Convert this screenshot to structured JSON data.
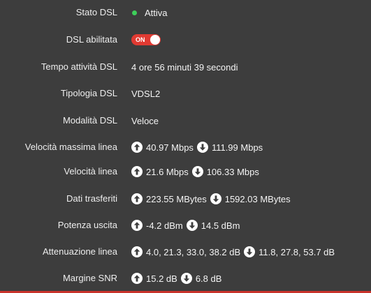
{
  "rows": {
    "stato": {
      "label": "Stato DSL",
      "value": "Attiva",
      "status_color": "#3ecf5a"
    },
    "abilitata": {
      "label": "DSL abilitata",
      "toggle_text": "ON",
      "toggle_on": true,
      "toggle_color": "#e03a32"
    },
    "tempo": {
      "label": "Tempo attività DSL",
      "value": "4 ore 56 minuti 39 secondi"
    },
    "tipologia": {
      "label": "Tipologia DSL",
      "value": "VDSL2"
    },
    "modalita": {
      "label": "Modalità DSL",
      "value": "Veloce"
    },
    "vel_max": {
      "label": "Velocità massima linea",
      "up": "40.97 Mbps",
      "down": "111.99 Mbps"
    },
    "vel": {
      "label": "Velocità linea",
      "up": "21.6 Mbps",
      "down": "106.33 Mbps"
    },
    "dati": {
      "label": "Dati trasferiti",
      "up": "223.55 MBytes",
      "down": "1592.03 MBytes"
    },
    "potenza": {
      "label": "Potenza uscita",
      "up": "-4.2 dBm",
      "down": "14.5 dBm"
    },
    "attenuazione": {
      "label": "Attenuazione linea",
      "up": "4.0, 21.3, 33.0, 38.2 dB",
      "down": "11.8, 27.8, 53.7 dB"
    },
    "snr": {
      "label": "Margine SNR",
      "up": "15.2 dB",
      "down": "6.8 dB"
    }
  },
  "icons": {
    "up": "arrow-up-circle-icon",
    "down": "arrow-down-circle-icon"
  }
}
